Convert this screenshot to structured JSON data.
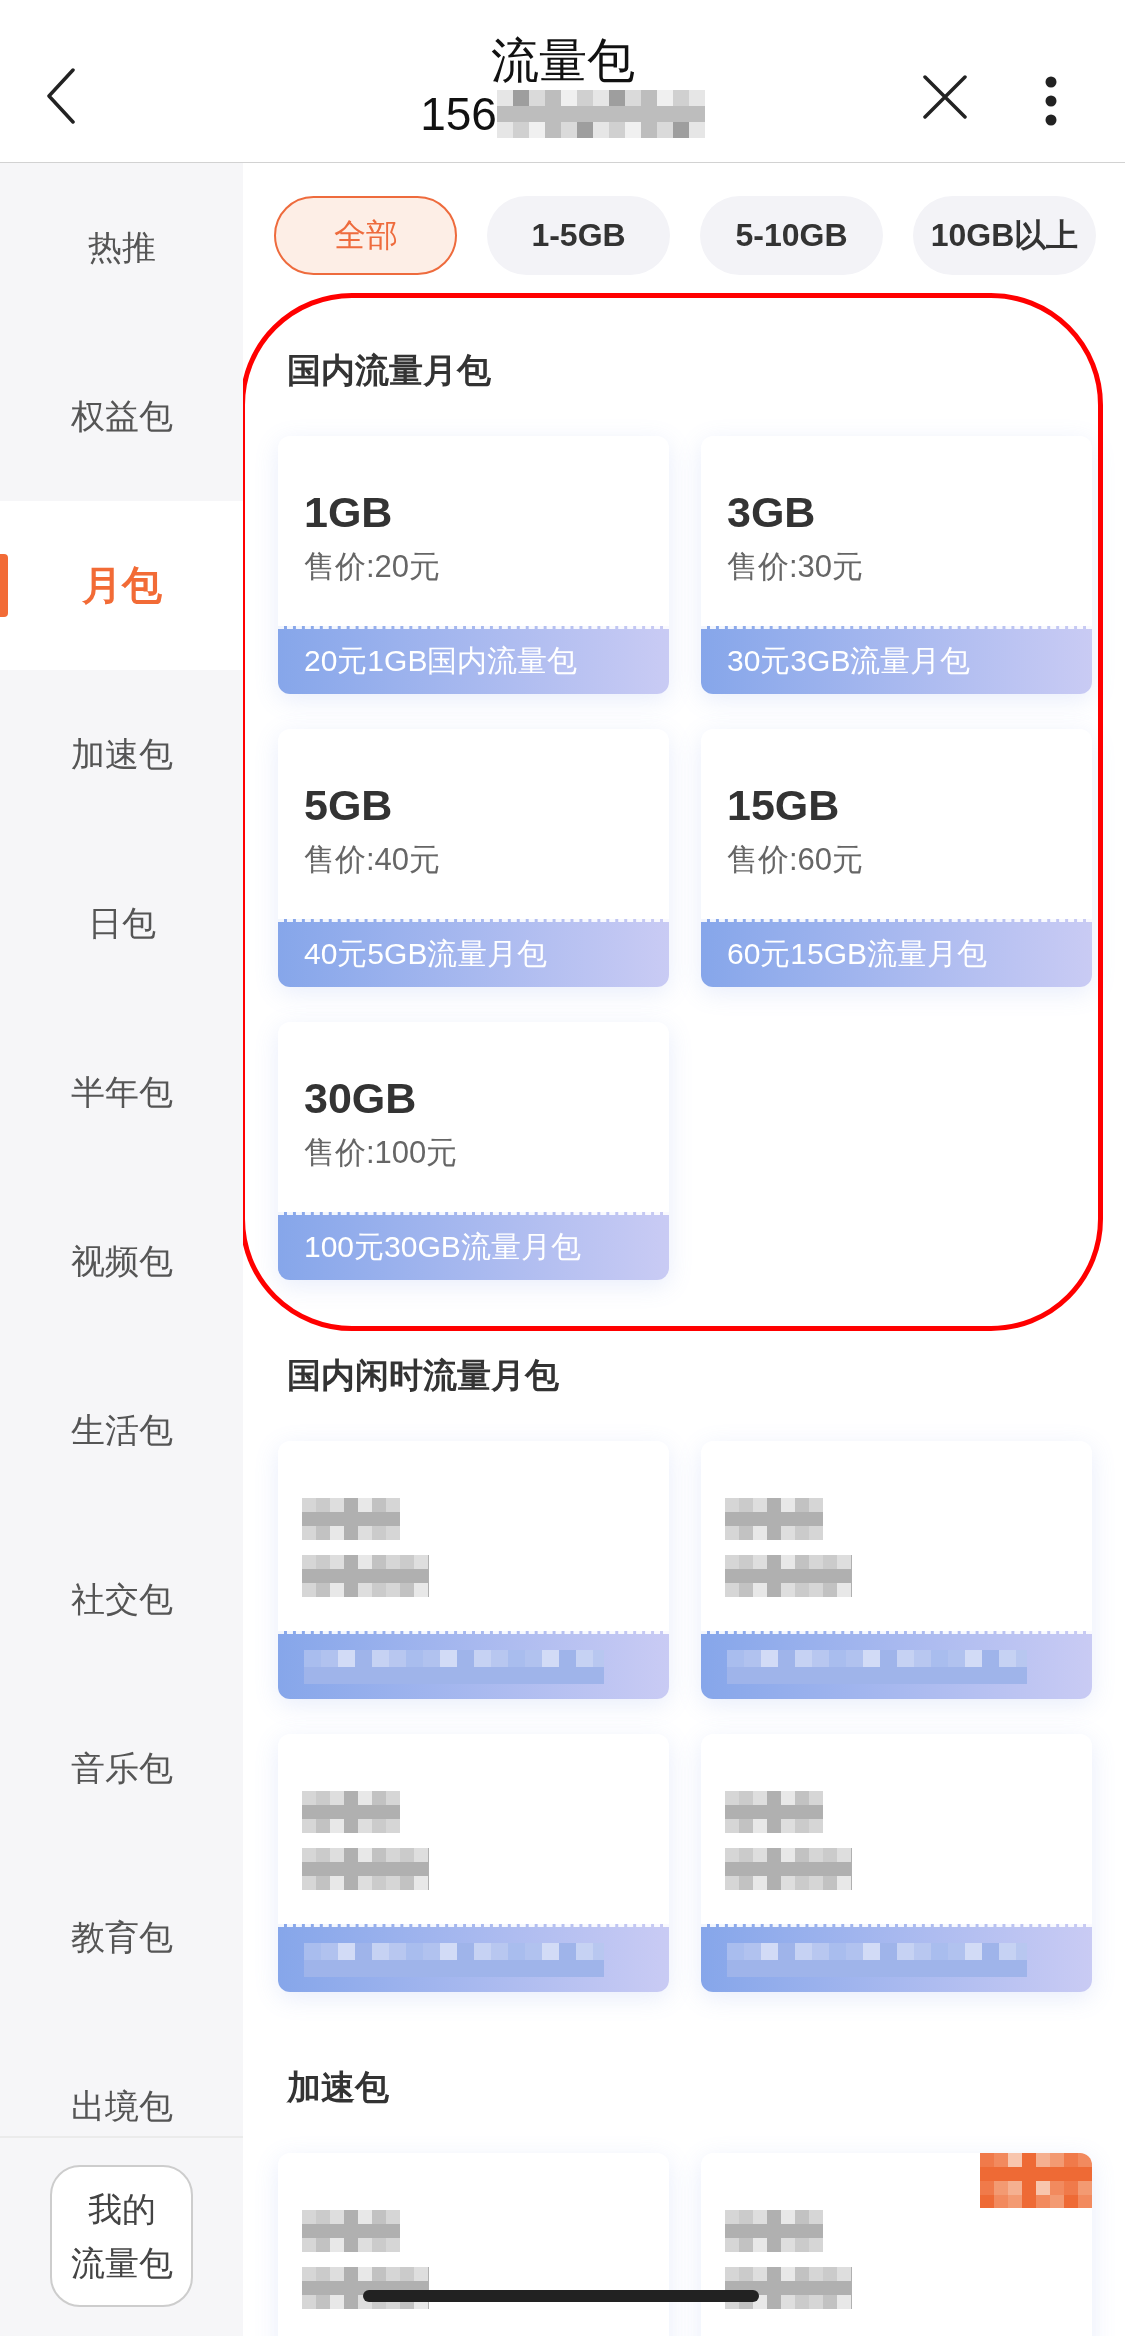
{
  "header": {
    "title": "流量包",
    "subtitle": {
      "text": "156",
      "redacted": true
    }
  },
  "sidebar": {
    "items": [
      {
        "label": "热推",
        "selected": false
      },
      {
        "label": "权益包",
        "selected": false
      },
      {
        "label": "月包",
        "selected": true
      },
      {
        "label": "加速包",
        "selected": false
      },
      {
        "label": "日包",
        "selected": false
      },
      {
        "label": "半年包",
        "selected": false
      },
      {
        "label": "视频包",
        "selected": false
      },
      {
        "label": "生活包",
        "selected": false
      },
      {
        "label": "社交包",
        "selected": false
      },
      {
        "label": "音乐包",
        "selected": false
      },
      {
        "label": "教育包",
        "selected": false
      },
      {
        "label": "出境包",
        "selected": false
      }
    ],
    "bottom_button": {
      "lines": [
        "我的",
        "流量包"
      ]
    }
  },
  "filters": [
    {
      "label": "全部",
      "selected": true
    },
    {
      "label": "1-5GB",
      "selected": false
    },
    {
      "label": "5-10GB",
      "selected": false
    },
    {
      "label": "10GB以上",
      "selected": false
    }
  ],
  "sections": [
    {
      "title": "国内流量月包",
      "highlighted": true,
      "cards": [
        {
          "size": "1GB",
          "price": "售价:20元",
          "name": "20元1GB国内流量包",
          "redacted": false,
          "badge": false
        },
        {
          "size": "3GB",
          "price": "售价:30元",
          "name": "30元3GB流量月包",
          "redacted": false,
          "badge": false
        },
        {
          "size": "5GB",
          "price": "售价:40元",
          "name": "40元5GB流量月包",
          "redacted": false,
          "badge": false
        },
        {
          "size": "15GB",
          "price": "售价:60元",
          "name": "60元15GB流量月包",
          "redacted": false,
          "badge": false
        },
        {
          "size": "30GB",
          "price": "售价:100元",
          "name": "100元30GB流量月包",
          "redacted": false,
          "badge": false
        }
      ]
    },
    {
      "title": "国内闲时流量月包",
      "highlighted": false,
      "cards": [
        {
          "redacted": true,
          "badge": false
        },
        {
          "redacted": true,
          "badge": false
        },
        {
          "redacted": true,
          "badge": false
        },
        {
          "redacted": true,
          "badge": false
        }
      ]
    },
    {
      "title": "加速包",
      "highlighted": false,
      "cards": [
        {
          "redacted": true,
          "badge": false
        },
        {
          "redacted": true,
          "badge": true
        }
      ]
    }
  ]
}
